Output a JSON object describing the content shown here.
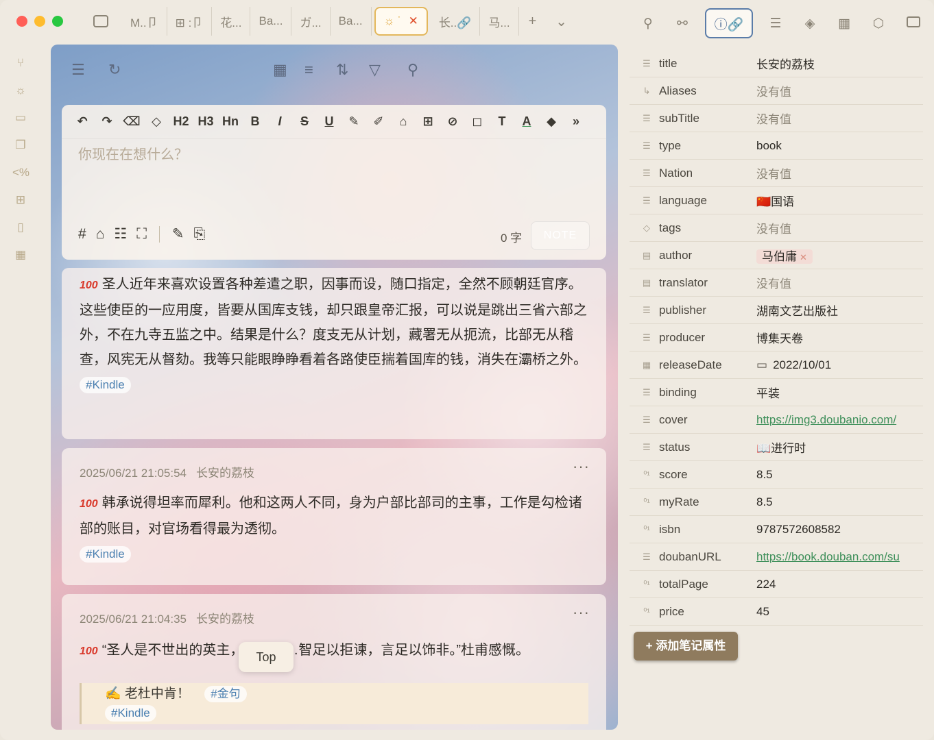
{
  "tabs": [
    {
      "label": "M..卩",
      "active": false
    },
    {
      "label": "⊞ :卩",
      "active": false
    },
    {
      "label": "花...",
      "active": false
    },
    {
      "label": "Ba...",
      "active": false
    },
    {
      "label": "ガ...",
      "active": false
    },
    {
      "label": "Ba...",
      "active": false
    },
    {
      "label": "☼ ˙",
      "active": true
    },
    {
      "label": "长..🔗",
      "active": false
    },
    {
      "label": "马...",
      "active": false
    }
  ],
  "tab_plus": "+",
  "tab_chevron": "⌄",
  "editor": {
    "placeholder": "你现在在想什么？",
    "word_count": "0 字",
    "note_button": "NOTE",
    "toolbar": [
      "↶",
      "↷",
      "⌫",
      "◇",
      "H2",
      "H3",
      "Hn",
      "B",
      "I",
      "S",
      "U",
      "✎",
      "✐",
      "⌂",
      "⊞",
      "⊘",
      "◻",
      "T",
      "A",
      "◆",
      "»"
    ]
  },
  "cards": [
    {
      "meta": "",
      "source": "",
      "text": "圣人近年来喜欢设置各种差遣之职，因事而设，随口指定，全然不顾朝廷官序。这些使臣的一应用度，皆要从国库支钱，却只跟皇帝汇报，可以说是跳出三省六部之外，不在九寺五监之中。结果是什么？度支无从计划，藏署无从扼流，比部无从稽查，风宪无从督劾。我等只能眼睁睁看着各路使臣揣着国库的钱，消失在灞桥之外。",
      "tags": [
        "#Kindle"
      ]
    },
    {
      "meta": "2025/06/21 21:05:54",
      "source": "长安的荔枝",
      "text": "韩承说得坦率而犀利。他和这两人不同，身为户部比部司的主事，工作是勾检诸部的账目，对官场看得最为透彻。",
      "tags": [
        "#Kindle"
      ]
    },
    {
      "meta": "2025/06/21 21:04:35",
      "source": "长安的荔枝",
      "text": "“圣人是不世出的英主，可惜……智足以拒谏，言足以饰非。”杜甫感慨。",
      "quote": "✍️ 老杜中肯！",
      "tags": [
        "#金句",
        "#Kindle"
      ]
    }
  ],
  "top_button": "Top",
  "properties": [
    {
      "key": "title",
      "value": "长安的荔枝",
      "icon": "text"
    },
    {
      "key": "Aliases",
      "value": "没有值",
      "icon": "alias"
    },
    {
      "key": "subTitle",
      "value": "没有值",
      "icon": "text"
    },
    {
      "key": "type",
      "value": "book",
      "icon": "text"
    },
    {
      "key": "Nation",
      "value": "没有值",
      "icon": "text"
    },
    {
      "key": "language",
      "value": "🇨🇳国语",
      "icon": "text"
    },
    {
      "key": "tags",
      "value": "没有值",
      "icon": "tag"
    },
    {
      "key": "author",
      "value": "马伯庸",
      "icon": "list"
    },
    {
      "key": "translator",
      "value": "没有值",
      "icon": "list"
    },
    {
      "key": "publisher",
      "value": "湖南文艺出版社",
      "icon": "text"
    },
    {
      "key": "producer",
      "value": "博集天卷",
      "icon": "text"
    },
    {
      "key": "releaseDate",
      "value": "2022/10/01",
      "icon": "date"
    },
    {
      "key": "binding",
      "value": "平装",
      "icon": "text"
    },
    {
      "key": "cover",
      "value": "https://img3.doubanio.com/",
      "icon": "text"
    },
    {
      "key": "status",
      "value": "📖进行时",
      "icon": "text"
    },
    {
      "key": "score",
      "value": "8.5",
      "icon": "number"
    },
    {
      "key": "myRate",
      "value": "8.5",
      "icon": "number"
    },
    {
      "key": "isbn",
      "value": "9787572608582",
      "icon": "number"
    },
    {
      "key": "doubanURL",
      "value": "https://book.douban.com/su",
      "icon": "text"
    },
    {
      "key": "totalPage",
      "value": "224",
      "icon": "number"
    },
    {
      "key": "price",
      "value": "45",
      "icon": "number"
    }
  ],
  "add_property": "+ 添加笔记属性",
  "colors": {
    "accent": "#e3b75b",
    "link": "#3e8f5a",
    "tag": "#4a7fb0",
    "button": "#8f7b5e"
  }
}
